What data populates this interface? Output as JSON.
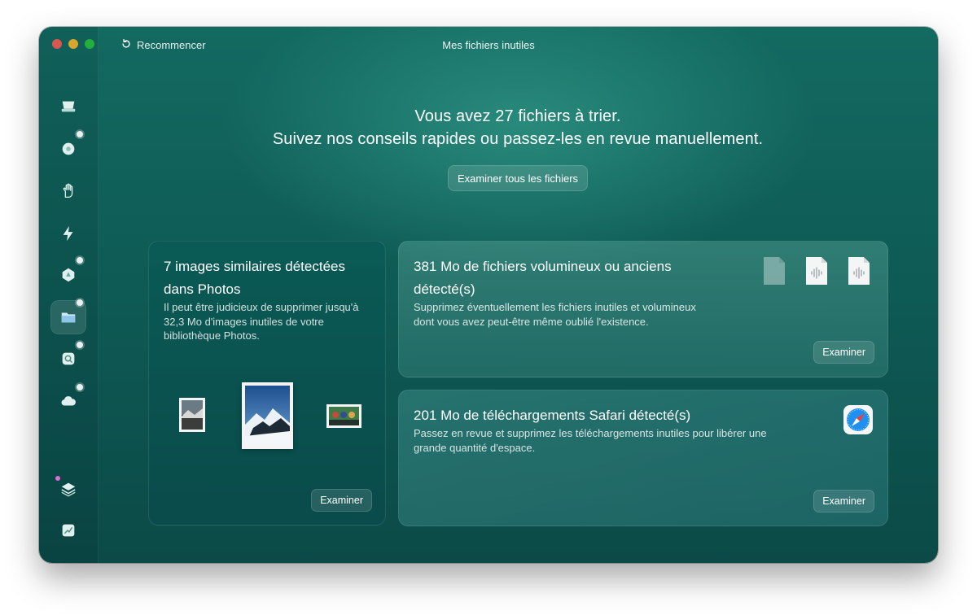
{
  "window": {
    "title": "Mes fichiers inutiles",
    "restart_label": "Recommencer"
  },
  "sidebar": {
    "items": [
      {
        "icon": "disk-icon",
        "badge": false
      },
      {
        "icon": "globe-icon",
        "badge": true
      },
      {
        "icon": "hand-icon",
        "badge": false
      },
      {
        "icon": "lightning-icon",
        "badge": false
      },
      {
        "icon": "apps-icon",
        "badge": true
      },
      {
        "icon": "folder-icon",
        "badge": true,
        "active": true
      },
      {
        "icon": "search-disk-icon",
        "badge": true
      },
      {
        "icon": "cloud-icon",
        "badge": true
      },
      {
        "icon": "layers-icon",
        "badge": false
      },
      {
        "icon": "chart-icon",
        "badge": false
      }
    ]
  },
  "headline": {
    "line1": "Vous avez 27 fichiers à trier.",
    "line2": "Suivez nos conseils rapides ou passez-les en revue manuellement."
  },
  "review_all_button": "Examiner tous les fichiers",
  "cards": {
    "photos": {
      "title": "7 images similaires détectées dans Photos",
      "description": "Il peut être judicieux de supprimer jusqu'à 32,3 Mo d'images inutiles de votre bibliothèque Photos.",
      "button": "Examiner"
    },
    "large_files": {
      "title_line1": "381 Mo de fichiers volumineux ou anciens",
      "title_line2": "détecté(s)",
      "description_line1": "Supprimez éventuellement les fichiers inutiles et volumineux",
      "description_line2": "dont vous avez peut-être même oublié l'existence.",
      "button": "Examiner",
      "file_icons": [
        "document-icon",
        "audio-file-icon",
        "audio-file-icon"
      ]
    },
    "safari": {
      "title": "201 Mo de téléchargements Safari détecté(s)",
      "description_line1": "Passez en revue et supprimez les téléchargements inutiles pour libérer une",
      "description_line2": "grande quantité d'espace.",
      "button": "Examiner",
      "icon": "safari-icon"
    }
  },
  "colors": {
    "window_bg": "#0f5d57",
    "close": "#ff5f57",
    "minimize": "#febc2e",
    "zoom": "#28c840",
    "notification_dot": "#e16ad1"
  }
}
